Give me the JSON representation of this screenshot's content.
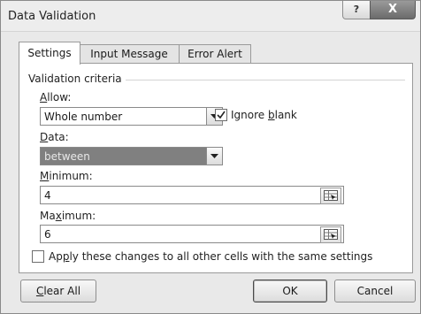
{
  "window": {
    "title": "Data Validation",
    "help_label": "?",
    "close_label": "X"
  },
  "tabs": [
    {
      "label": "Settings",
      "active": true
    },
    {
      "label": "Input Message",
      "active": false
    },
    {
      "label": "Error Alert",
      "active": false
    }
  ],
  "settings": {
    "group_label": "Validation criteria",
    "allow": {
      "label_accel": "A",
      "label_rest": "llow:",
      "value": "Whole number"
    },
    "ignore_blank": {
      "label_pre": "Ignore ",
      "label_accel": "b",
      "label_post": "lank",
      "checked": true
    },
    "data": {
      "label_accel": "D",
      "label_rest": "ata:",
      "value": "between",
      "disabled": true
    },
    "minimum": {
      "label_accel": "M",
      "label_rest": "inimum:",
      "value": "4"
    },
    "maximum": {
      "label_pre": "Ma",
      "label_accel": "x",
      "label_post": "imum:",
      "value": "6"
    },
    "apply_all": {
      "label_pre": "Ap",
      "label_accel": "p",
      "label_post": "ly these changes to all other cells with the same settings",
      "checked": false
    }
  },
  "buttons": {
    "clear_all": {
      "label_accel": "C",
      "label_rest": "lear All"
    },
    "ok": "OK",
    "cancel": "Cancel"
  },
  "colors": {
    "disabled_field": "#808080",
    "panel": "#ffffff",
    "dialog": "#e9e9e9"
  },
  "icons": [
    "help-icon",
    "close-icon",
    "dropdown-arrow-icon",
    "checkmark-icon",
    "range-select-icon"
  ]
}
